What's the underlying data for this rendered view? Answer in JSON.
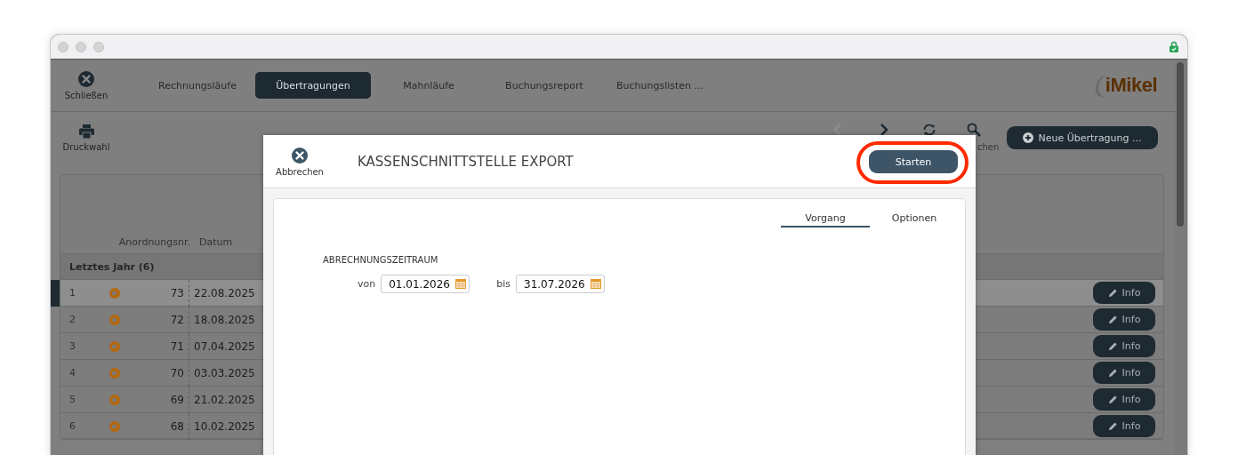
{
  "toolbar": {
    "close_label": "Schließen",
    "tabs": [
      {
        "label": "Rechnungsläufe",
        "selected": false
      },
      {
        "label": "Übertragungen",
        "selected": true
      },
      {
        "label": "Mahnläufe",
        "selected": false
      },
      {
        "label": "Buchungsreport",
        "selected": false
      },
      {
        "label": "Buchungslisten ...",
        "selected": false
      }
    ],
    "logo": "iMikel"
  },
  "actions": {
    "print_label": "Druckwahl",
    "search_label": "chen",
    "new_button": "Neue Übertragung ..."
  },
  "table": {
    "columns": [
      "Anordnungsnr.",
      "Datum"
    ],
    "group": "Letztes Jahr (6)",
    "rows": [
      {
        "index": "1",
        "number": "73",
        "date": "22.08.2025",
        "action": "Info",
        "selected": true
      },
      {
        "index": "2",
        "number": "72",
        "date": "18.08.2025",
        "action": "Info",
        "selected": false
      },
      {
        "index": "3",
        "number": "71",
        "date": "07.04.2025",
        "action": "Info",
        "selected": false
      },
      {
        "index": "4",
        "number": "70",
        "date": "03.03.2025",
        "action": "Info",
        "selected": false
      },
      {
        "index": "5",
        "number": "69",
        "date": "21.02.2025",
        "action": "Info",
        "selected": false
      },
      {
        "index": "6",
        "number": "68",
        "date": "10.02.2025",
        "action": "Info",
        "selected": false
      }
    ]
  },
  "dialog": {
    "cancel_label": "Abbrechen",
    "title": "KASSENSCHNITTSTELLE EXPORT",
    "start_button": "Starten",
    "start_highlighted": true,
    "tabs": [
      {
        "label": "Vorgang",
        "selected": true
      },
      {
        "label": "Optionen",
        "selected": false
      }
    ],
    "section_title": "ABRECHNUNGSZEITRAUM",
    "from_label": "von",
    "from_value": "01.01.2026",
    "to_label": "bis",
    "to_value": "31.07.2026"
  }
}
